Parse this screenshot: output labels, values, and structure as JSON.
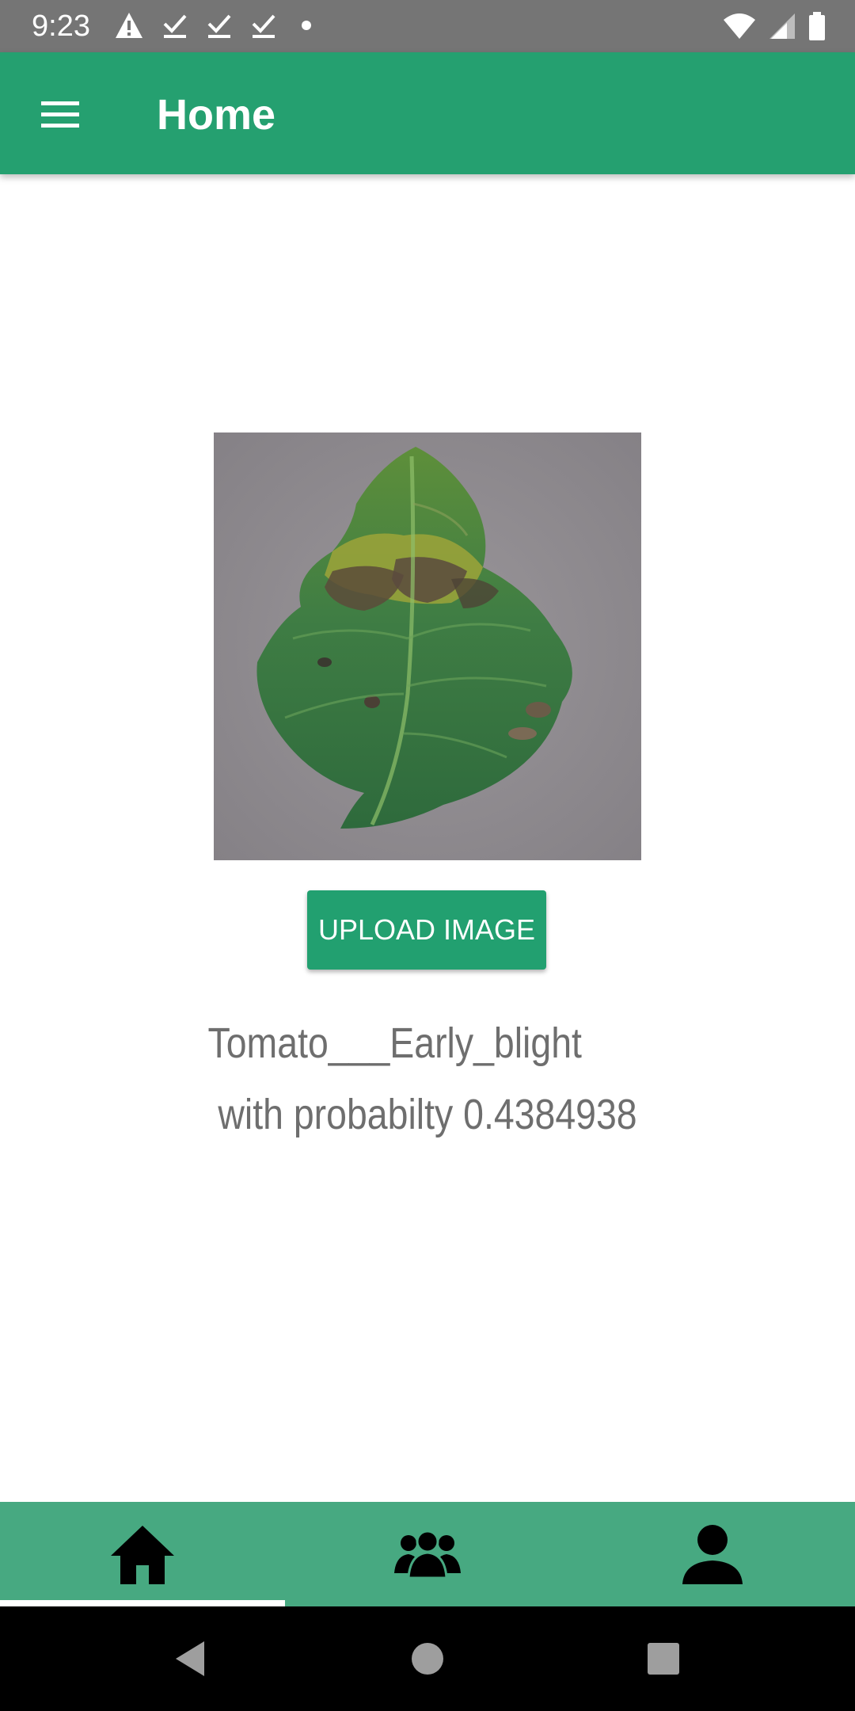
{
  "status_bar": {
    "time": "9:23",
    "left_icons": [
      "warning-icon",
      "download-done-icon",
      "download-done-icon",
      "download-done-icon",
      "dot-icon"
    ],
    "right_icons": [
      "wifi-icon",
      "signal-icon",
      "battery-icon"
    ]
  },
  "app_bar": {
    "title": "Home",
    "menu_icon": "hamburger-menu-icon",
    "color": "#25a070"
  },
  "main": {
    "image_subject": "tomato leaf",
    "upload_button_label": "UPLOAD IMAGE",
    "result_label": "Tomato___Early_blight",
    "result_probability_text": "with probabilty 0.4384938"
  },
  "bottom_nav": {
    "items": [
      {
        "icon": "home-icon",
        "selected": true
      },
      {
        "icon": "group-icon",
        "selected": false
      },
      {
        "icon": "person-icon",
        "selected": false
      }
    ],
    "color": "#47a981"
  },
  "system_nav": {
    "buttons": [
      "back-icon",
      "home-circle-icon",
      "recents-icon"
    ]
  }
}
